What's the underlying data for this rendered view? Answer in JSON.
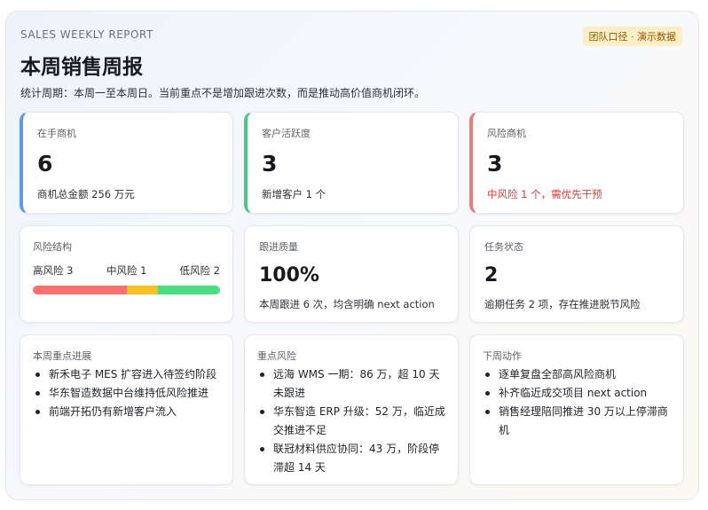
{
  "header": {
    "eyebrow": "SALES WEEKLY REPORT",
    "badge": "团队口径 · 演示数据",
    "title": "本周销售周报",
    "subtitle": "统计周期：本周一至本周日。当前重点不是增加跟进次数，而是推动高价值商机闭环。"
  },
  "kpis": [
    {
      "label": "在手商机",
      "value": "6",
      "note": "商机总金额 256 万元"
    },
    {
      "label": "客户活跃度",
      "value": "3",
      "note": "新增客户 1 个"
    },
    {
      "label": "风险商机",
      "value": "3",
      "note": "中风险 1 个，需优先干预"
    }
  ],
  "risk_structure": {
    "label": "风险结构",
    "high_label": "高风险 3",
    "mid_label": "中风险 1",
    "low_label": "低风险 2",
    "high": 3,
    "mid": 1,
    "low": 2,
    "colors": {
      "high": "#f87171",
      "mid": "#fbbf24",
      "low": "#4ade80"
    }
  },
  "follow_quality": {
    "label": "跟进质量",
    "value": "100%",
    "note": "本周跟进 6 次，均含明确 next action"
  },
  "task_status": {
    "label": "任务状态",
    "value": "2",
    "note": "逾期任务 2 项，存在推进脱节风险"
  },
  "progress": {
    "label": "本周重点进展",
    "items": [
      "新禾电子 MES 扩容进入待签约阶段",
      "华东智造数据中台维持低风险推进",
      "前端开拓仍有新增客户流入"
    ]
  },
  "key_risks": {
    "label": "重点风险",
    "items": [
      "远海 WMS 一期：86 万，超 10 天未跟进",
      "华东智造 ERP 升级：52 万，临近成交推进不足",
      "联冠材料供应协同：43 万，阶段停滞超 14 天"
    ]
  },
  "next_actions": {
    "label": "下周动作",
    "items": [
      "逐单复盘全部高风险商机",
      "补齐临近成交项目 next action",
      "销售经理陪同推进 30 万以上停滞商机"
    ]
  }
}
